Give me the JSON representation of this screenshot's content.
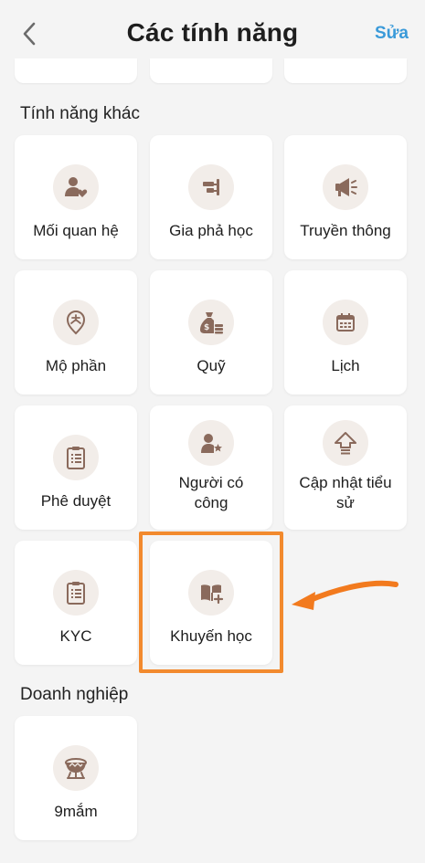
{
  "header": {
    "title": "Các tính năng",
    "edit_label": "Sửa"
  },
  "sections": {
    "other_title": "Tính năng khác",
    "business_title": "Doanh nghiệp"
  },
  "features": [
    {
      "label": "Mối quan hệ",
      "icon": "relationship-icon"
    },
    {
      "label": "Gia phả học",
      "icon": "genealogy-icon"
    },
    {
      "label": "Truyền thông",
      "icon": "megaphone-icon"
    },
    {
      "label": "Mộ phần",
      "icon": "grave-location-icon"
    },
    {
      "label": "Quỹ",
      "icon": "money-bag-icon"
    },
    {
      "label": "Lịch",
      "icon": "calendar-icon"
    },
    {
      "label": "Phê duyệt",
      "icon": "clipboard-icon"
    },
    {
      "label": "Người có công",
      "icon": "person-star-icon"
    },
    {
      "label": "Cập nhật tiểu sử",
      "icon": "upload-arrow-icon"
    },
    {
      "label": "KYC",
      "icon": "clipboard-icon"
    },
    {
      "label": "Khuyến học",
      "icon": "book-plus-icon"
    }
  ],
  "business": [
    {
      "label": "9mắm",
      "icon": "bowl-icon"
    }
  ],
  "colors": {
    "accent": "#3a9ad9",
    "icon_brown": "#8a6a5c",
    "icon_bg": "#f2ede9",
    "highlight": "#f28a2e"
  }
}
